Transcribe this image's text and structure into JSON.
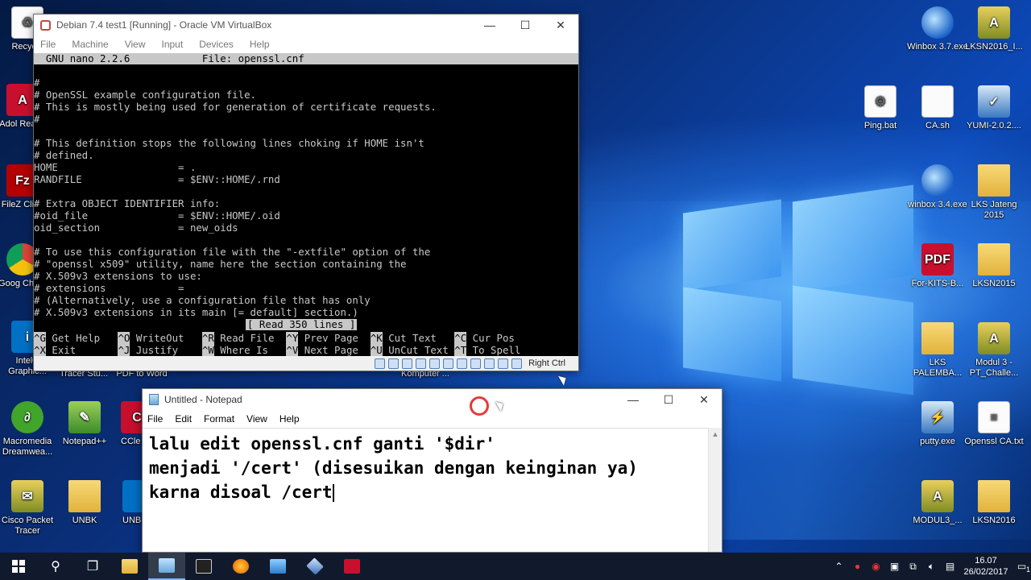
{
  "desktop": {
    "left_icons": [
      {
        "label": "Recycle",
        "name": "recycle-bin"
      },
      {
        "label": "Adol Reade",
        "name": "adobe-reader"
      },
      {
        "label": "FileZ Clien",
        "name": "filezilla-client"
      },
      {
        "label": "Goog Chron",
        "name": "google-chrome"
      },
      {
        "label": "Intel® Graphic...",
        "name": "intel-graphics"
      },
      {
        "label": "Macromedia Dreamwea...",
        "name": "macromedia-dreamweaver"
      },
      {
        "label": "Cisco Packet Tracer",
        "name": "cisco-packet-tracer"
      }
    ],
    "mid_icons": [
      {
        "label": "Tracer Stu...",
        "name": "tracer-student"
      },
      {
        "label": "PDF to Word",
        "name": "pdf-to-word"
      },
      {
        "label": "Notepad++",
        "name": "notepad-plus-plus"
      },
      {
        "label": "CCle",
        "name": "ccleaner"
      },
      {
        "label": "UNBK",
        "name": "unbk-folder"
      },
      {
        "label": "UNB",
        "name": "unb-app"
      },
      {
        "label": "Komputer ...",
        "name": "komputer"
      }
    ],
    "right_icons": [
      {
        "label": "Winbox 3.7.exe",
        "name": "winbox-37"
      },
      {
        "label": "LKSN2016_I...",
        "name": "lksn2016"
      },
      {
        "label": "Ping.bat",
        "name": "ping-bat"
      },
      {
        "label": "CA.sh",
        "name": "ca-sh"
      },
      {
        "label": "YUMI-2.0.2....",
        "name": "yumi"
      },
      {
        "label": "winbox 3.4.exe",
        "name": "winbox-34"
      },
      {
        "label": "LKS Jateng 2015",
        "name": "lks-jateng-2015"
      },
      {
        "label": "For-KITS-B...",
        "name": "for-kits"
      },
      {
        "label": "LKSN2015",
        "name": "lksn2015"
      },
      {
        "label": "LKS PALEMBA...",
        "name": "lks-palembang"
      },
      {
        "label": "Modul 3 - PT_Challe...",
        "name": "modul-3"
      },
      {
        "label": "putty.exe",
        "name": "putty"
      },
      {
        "label": "Openssl CA.txt",
        "name": "openssl-ca-txt"
      },
      {
        "label": "MODUL3_...",
        "name": "modul3"
      },
      {
        "label": "LKSN2016",
        "name": "lksn2016-folder"
      }
    ]
  },
  "vbox": {
    "title": "Debian 7.4 test1 [Running] - Oracle VM VirtualBox",
    "menu": [
      "File",
      "Machine",
      "View",
      "Input",
      "Devices",
      "Help"
    ],
    "terminal_header": "  GNU nano 2.2.6            File: openssl.cnf",
    "terminal_lines": [
      "",
      "#",
      "# OpenSSL example configuration file.",
      "# This is mostly being used for generation of certificate requests.",
      "#",
      "",
      "# This definition stops the following lines choking if HOME isn't",
      "# defined.",
      "HOME                    = .",
      "RANDFILE                = $ENV::HOME/.rnd",
      "",
      "# Extra OBJECT IDENTIFIER info:",
      "#oid_file               = $ENV::HOME/.oid",
      "oid_section             = new_oids",
      "",
      "# To use this configuration file with the \"-extfile\" option of the",
      "# \"openssl x509\" utility, name here the section containing the",
      "# X.509v3 extensions to use:",
      "# extensions            =",
      "# (Alternatively, use a configuration file that has only",
      "# X.509v3 extensions in its main [= default] section.)"
    ],
    "status_message": "[ Read 350 lines ]",
    "shortcuts_row1": [
      {
        "key": "^G",
        "label": " Get Help  "
      },
      {
        "key": "^O",
        "label": " WriteOut  "
      },
      {
        "key": "^R",
        "label": " Read File "
      },
      {
        "key": "^Y",
        "label": " Prev Page "
      },
      {
        "key": "^K",
        "label": " Cut Text  "
      },
      {
        "key": "^C",
        "label": " Cur Pos"
      }
    ],
    "shortcuts_row2": [
      {
        "key": "^X",
        "label": " Exit      "
      },
      {
        "key": "^J",
        "label": " Justify   "
      },
      {
        "key": "^W",
        "label": " Where Is  "
      },
      {
        "key": "^V",
        "label": " Next Page "
      },
      {
        "key": "^U",
        "label": " UnCut Text"
      },
      {
        "key": "^T",
        "label": " To Spell"
      }
    ],
    "host_key": "Right Ctrl"
  },
  "notepad": {
    "title": "Untitled - Notepad",
    "menu": [
      "File",
      "Edit",
      "Format",
      "View",
      "Help"
    ],
    "text_lines": [
      "lalu edit openssl.cnf ganti '$dir'",
      "menjadi '/cert' (disesuikan dengan keinginan ya)",
      "karna disoal /cert"
    ]
  },
  "taskbar": {
    "time": "16.07",
    "date": "26/02/2017",
    "notification_count": "1",
    "apps": [
      "file-explorer",
      "notepad",
      "terminal",
      "firefox",
      "control-panel",
      "virtualbox",
      "acrobat"
    ]
  }
}
